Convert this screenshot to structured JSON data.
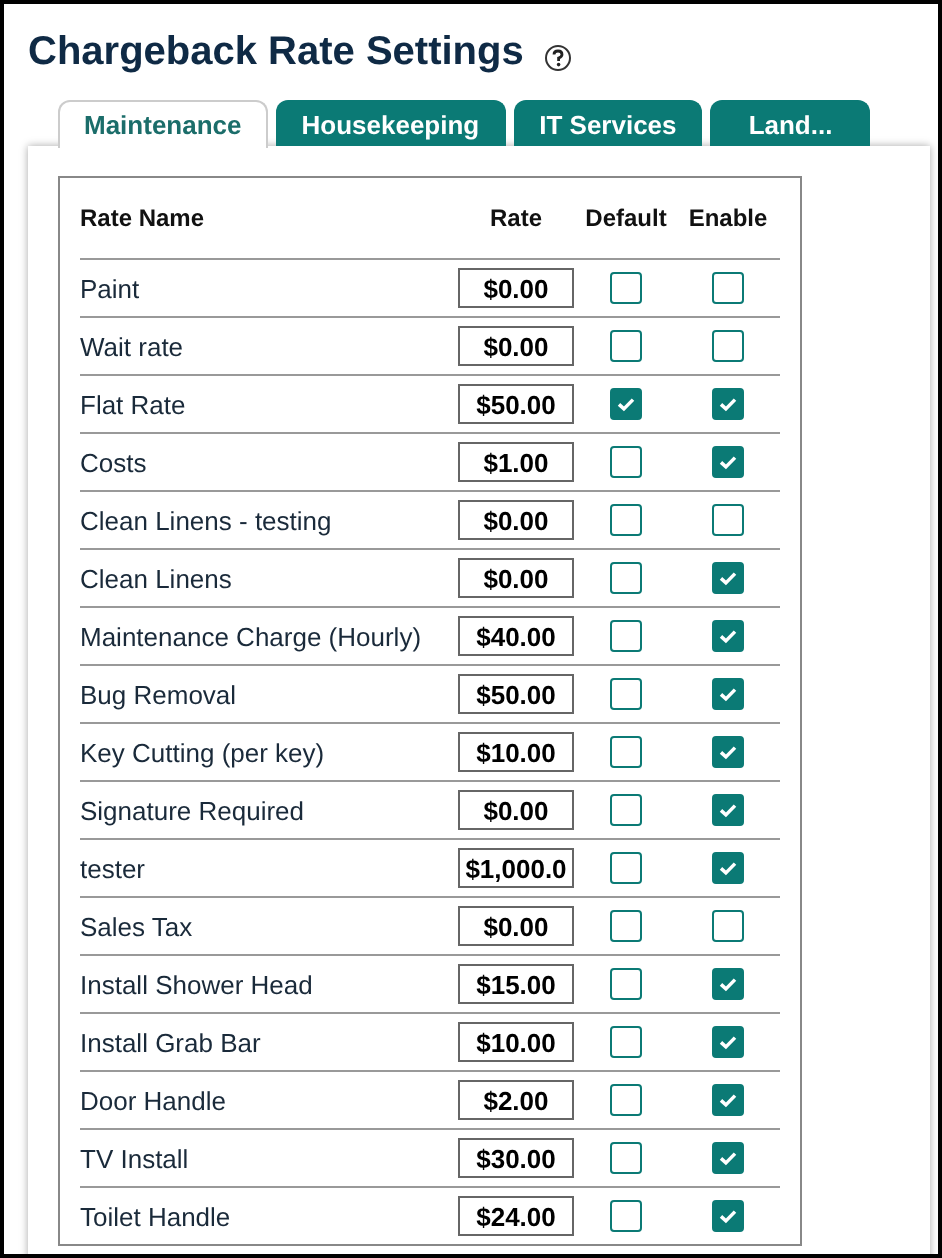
{
  "title": "Chargeback Rate Settings",
  "tabs": [
    {
      "label": "Maintenance",
      "selected": true
    },
    {
      "label": "Housekeeping",
      "selected": false
    },
    {
      "label": "IT Services",
      "selected": false
    },
    {
      "label": "Land...",
      "selected": false
    }
  ],
  "columns": [
    "Rate Name",
    "Rate",
    "Default",
    "Enable"
  ],
  "rows": [
    {
      "name": "Paint",
      "rate": "$0.00",
      "default": false,
      "enable": false
    },
    {
      "name": "Wait rate",
      "rate": "$0.00",
      "default": false,
      "enable": false
    },
    {
      "name": "Flat Rate",
      "rate": "$50.00",
      "default": true,
      "enable": true
    },
    {
      "name": "Costs",
      "rate": "$1.00",
      "default": false,
      "enable": true
    },
    {
      "name": "Clean Linens - testing",
      "rate": "$0.00",
      "default": false,
      "enable": false
    },
    {
      "name": "Clean Linens",
      "rate": "$0.00",
      "default": false,
      "enable": true
    },
    {
      "name": "Maintenance Charge (Hourly)",
      "rate": "$40.00",
      "default": false,
      "enable": true
    },
    {
      "name": "Bug Removal",
      "rate": "$50.00",
      "default": false,
      "enable": true
    },
    {
      "name": "Key Cutting (per key)",
      "rate": "$10.00",
      "default": false,
      "enable": true
    },
    {
      "name": "Signature Required",
      "rate": "$0.00",
      "default": false,
      "enable": true
    },
    {
      "name": "tester",
      "rate": "$1,000.0",
      "default": false,
      "enable": true
    },
    {
      "name": "Sales Tax",
      "rate": "$0.00",
      "default": false,
      "enable": false
    },
    {
      "name": "Install Shower Head",
      "rate": "$15.00",
      "default": false,
      "enable": true
    },
    {
      "name": "Install Grab Bar",
      "rate": "$10.00",
      "default": false,
      "enable": true
    },
    {
      "name": "Door Handle",
      "rate": "$2.00",
      "default": false,
      "enable": true
    },
    {
      "name": "TV Install",
      "rate": "$30.00",
      "default": false,
      "enable": true
    },
    {
      "name": "Toilet Handle",
      "rate": "$24.00",
      "default": false,
      "enable": true
    }
  ]
}
